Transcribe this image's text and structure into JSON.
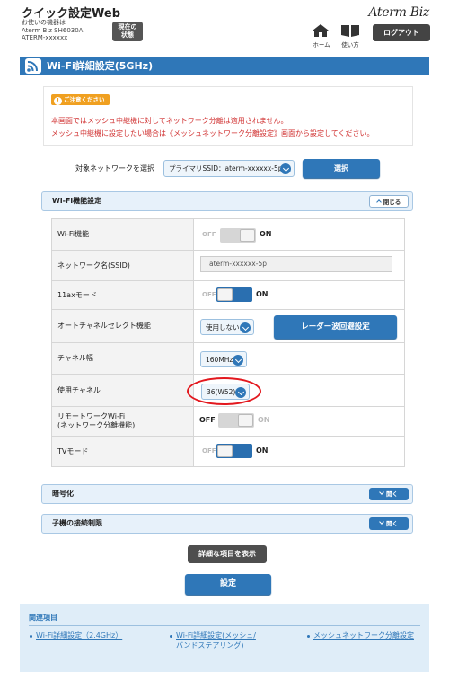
{
  "header": {
    "app_title": "クイック設定Web",
    "device_caption": "お使いの機器は",
    "device_model": "Aterm Biz SH6030A",
    "device_id": "ATERM-xxxxxx",
    "status_button": [
      "現在の",
      "状態"
    ],
    "brand": "Aterm Biz",
    "home_label": "ホーム",
    "manual_label": "使い方",
    "logout_label": "ログアウト"
  },
  "page_title": "Wi-Fi詳細設定(5GHz)",
  "notice": {
    "badge": "ご注意ください",
    "line1": "本画面ではメッシュ中継機に対してネットワーク分離は適用されません。",
    "line2": "メッシュ中継機に設定したい場合は《メッシュネットワーク分離設定》画面から設定してください。"
  },
  "network_select": {
    "label": "対象ネットワークを選択",
    "value": "プライマリSSID：aterm-xxxxxx-5p",
    "button": "選択"
  },
  "wifi_section": {
    "title": "Wi-Fi機能設定",
    "collapse_label": "閉じる",
    "off_label": "OFF",
    "on_label": "ON",
    "rows": {
      "wifi": {
        "label": "Wi-Fi機能",
        "state": "on"
      },
      "ssid": {
        "label": "ネットワーク名(SSID)",
        "value": "aterm-xxxxxx-5p"
      },
      "ax": {
        "label": "11axモード",
        "state": "on"
      },
      "auto_channel": {
        "label": "オートチャネルセレクト機能",
        "value": "使用しない",
        "button": "レーダー波回避設定"
      },
      "bandwidth": {
        "label": "チャネル幅",
        "value": "160MHz"
      },
      "channel": {
        "label": "使用チャネル",
        "value": "36(W52)"
      },
      "remote": {
        "label_line1": "リモートワークWi-Fi",
        "label_line2": "(ネットワーク分離機能)",
        "state": "off"
      },
      "tv": {
        "label": "TVモード",
        "state": "on"
      }
    }
  },
  "encryption_section": {
    "title": "暗号化",
    "expand_label": "開く"
  },
  "child_section": {
    "title": "子機の接続制限",
    "expand_label": "開く"
  },
  "detail_button": "詳細な項目を表示",
  "set_button": "設定",
  "related": {
    "title": "関連項目",
    "links": [
      "Wi-Fi詳細設定（2.4GHz）",
      "Wi-Fi詳細設定(メッシュ/",
      "バンドステアリング)",
      "メッシュネットワーク分離設定"
    ]
  },
  "colors": {
    "accent": "#2f77b8",
    "warning": "#d03030",
    "highlight": "#e3181e"
  }
}
